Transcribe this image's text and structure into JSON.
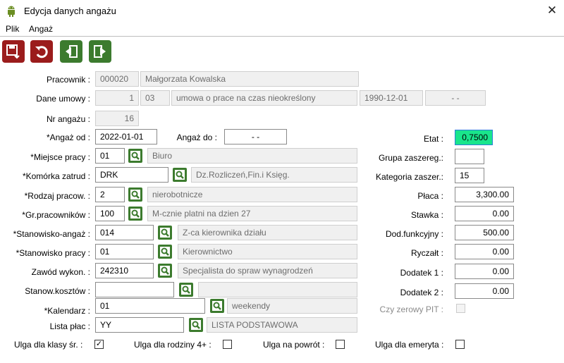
{
  "window": {
    "title": "Edycja danych angażu",
    "app_icon": "android-icon",
    "close_icon": "close-icon"
  },
  "menu": {
    "file": "Plik",
    "engagement": "Angaż"
  },
  "toolbar": {
    "save_icon": "save-icon",
    "undo_icon": "undo-icon",
    "prev_icon": "prev-record-icon",
    "next_icon": "next-record-icon",
    "colors": {
      "red": "#9b1c1c",
      "green": "#3c7b2e"
    }
  },
  "pracownik": {
    "label": "Pracownik :",
    "code": "000020",
    "name": "Małgorzata Kowalska"
  },
  "umowa": {
    "label": "Dane umowy :",
    "number": "1",
    "type_code": "03",
    "type_name": "umowa o prace na czas nieokreślony",
    "date_from": "1990-12-01",
    "date_to": "- -"
  },
  "nr_angazu": {
    "label": "Nr angażu :",
    "value": "16"
  },
  "angaz_od": {
    "label": "*Angaż od :",
    "value": "2022-01-01"
  },
  "angaz_do": {
    "label": "Angaż do :",
    "value": "- -"
  },
  "miejsce_pracy": {
    "label": "*Miejsce pracy :",
    "code": "01",
    "name": "Biuro"
  },
  "komorka": {
    "label": "*Komórka zatrud :",
    "code": "DRK",
    "name": "Dz.Rozliczeń,Fin.i Księg."
  },
  "rodzaj_pracow": {
    "label": "*Rodzaj pracow. :",
    "code": "2",
    "name": "nierobotnicze"
  },
  "gr_pracownikow": {
    "label": "*Gr.pracowników :",
    "code": "100",
    "name": "M-cznie platni na dzien 27"
  },
  "stanowisko_angaz": {
    "label": "*Stanowisko-angaż :",
    "code": "014",
    "name": "Z-ca kierownika działu"
  },
  "stanowisko_pracy": {
    "label": "*Stanowisko pracy :",
    "code": "01",
    "name": "Kierownictwo"
  },
  "zawod": {
    "label": "Zawód wykon. :",
    "code": "242310",
    "name": "Specjalista do spraw wynagrodzeń"
  },
  "stanow_kosztow": {
    "label": "Stanow.kosztów :",
    "code": "",
    "name": ""
  },
  "kalendarz": {
    "label": "*Kalendarz :",
    "code": "01",
    "name": "weekendy"
  },
  "lista_plac": {
    "label": "Lista płac :",
    "code": "YY",
    "name": "LISTA PODSTAWOWA"
  },
  "right": {
    "etat": {
      "label": "Etat :",
      "value": "0,7500",
      "highlight_color": "#19e58c"
    },
    "grupa": {
      "label": "Grupa zaszereg.:",
      "value": ""
    },
    "kategoria": {
      "label": "Kategoria zaszer.:",
      "value": "15"
    },
    "placa": {
      "label": "Płaca :",
      "value": "3,300.00"
    },
    "stawka": {
      "label": "Stawka :",
      "value": "0.00"
    },
    "dod_funkcyjny": {
      "label": "Dod.funkcyjny :",
      "value": "500.00"
    },
    "ryczalt": {
      "label": "Ryczałt :",
      "value": "0.00"
    },
    "dodatek1": {
      "label": "Dodatek 1 :",
      "value": "0.00"
    },
    "dodatek2": {
      "label": "Dodatek 2 :",
      "value": "0.00"
    },
    "zerowy_pit": {
      "label": "Czy zerowy PIT :",
      "checked": false,
      "disabled": true
    }
  },
  "ulgi": {
    "klasy_sr": {
      "label": "Ulga dla klasy śr. :",
      "mark": "✓"
    },
    "rodziny": {
      "label": "Ulga dla rodziny 4+ :",
      "mark": ""
    },
    "powrot": {
      "label": "Ulga na powrót :",
      "mark": ""
    },
    "emeryta": {
      "label": "Ulga dla emeryta :",
      "mark": ""
    }
  },
  "search_icon": "magnifier-icon"
}
